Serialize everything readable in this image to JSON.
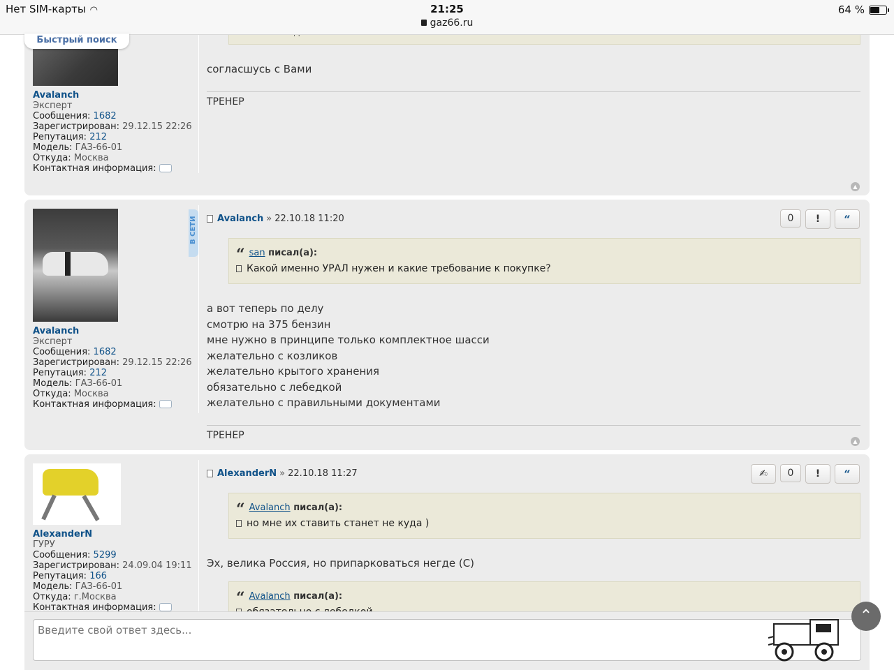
{
  "status": {
    "carrier": "Нет SIM-карты",
    "time": "21:25",
    "url": "gaz66.ru",
    "battery": "64 %",
    "battery_level": 0.64
  },
  "quick_search": "Быстрый поиск",
  "post1": {
    "partial_quote": "…это всё водителем…",
    "user": "Avalanch",
    "rank": "Эксперт",
    "posts_label": "Сообщения:",
    "posts": "1682",
    "reg_label": "Зарегистрирован:",
    "reg": "29.12.15 22:26",
    "rep_label": "Репутация:",
    "rep": "212",
    "model_label": "Модель:",
    "model": "ГАЗ-66-01",
    "from_label": "Откуда:",
    "from": "Москва",
    "contact_label": "Контактная информация:",
    "text": "согласшусь с Вами",
    "signature": "ТРЕНЕР"
  },
  "post2": {
    "online": "В СЕТИ",
    "user": "Avalanch",
    "rank": "Эксперт",
    "posts_label": "Сообщения:",
    "posts": "1682",
    "reg_label": "Зарегистрирован:",
    "reg": "29.12.15 22:26",
    "rep_label": "Репутация:",
    "rep": "212",
    "model_label": "Модель:",
    "model": "ГАЗ-66-01",
    "from_label": "Откуда:",
    "from": "Москва",
    "contact_label": "Контактная информация:",
    "author": "Avalanch",
    "date": "22.10.18 11:20",
    "likes": "0",
    "report": "!",
    "quote_btn": "“",
    "quote_author": "san",
    "quote_wrote": "писал(а):",
    "quote_text": "Какой именно УРАЛ нужен и какие требование к покупке?",
    "lines": [
      "а вот теперь по делу",
      "смотрю на 375 бензин",
      "мне нужно в принципе только комплектное шасси",
      "желательно с козликов",
      "желательно крытого хранения",
      "обязательно с лебедкой",
      "желательно с правильными документами"
    ],
    "signature": "ТРЕНЕР"
  },
  "post3": {
    "user": "AlexanderN",
    "rank": "ГУРУ",
    "posts_label": "Сообщения:",
    "posts": "5299",
    "reg_label": "Зарегистрирован:",
    "reg": "24.09.04 19:11",
    "rep_label": "Репутация:",
    "rep": "166",
    "model_label": "Модель:",
    "model": "ГАЗ-66-01",
    "from_label": "Откуда:",
    "from": "г.Москва",
    "contact_label": "Контактная информация:",
    "author": "AlexanderN",
    "date": "22.10.18 11:27",
    "likes": "0",
    "report": "!",
    "quote_btn": "“",
    "quote1_author": "Avalanch",
    "quote1_wrote": "писал(а):",
    "quote1_text": "но мне их ставить станет не куда )",
    "text": "Эх, велика Россия, но припарковаться негде (С)",
    "quote2_author": "Avalanch",
    "quote2_wrote": "писал(а):",
    "quote2_text": "обязательно с лебедкой"
  },
  "reply": {
    "placeholder": "Введите свой ответ здесь..."
  },
  "colors": {
    "link": "#105289",
    "post_bg": "#ececec",
    "quote_bg": "#ebe9d9"
  }
}
